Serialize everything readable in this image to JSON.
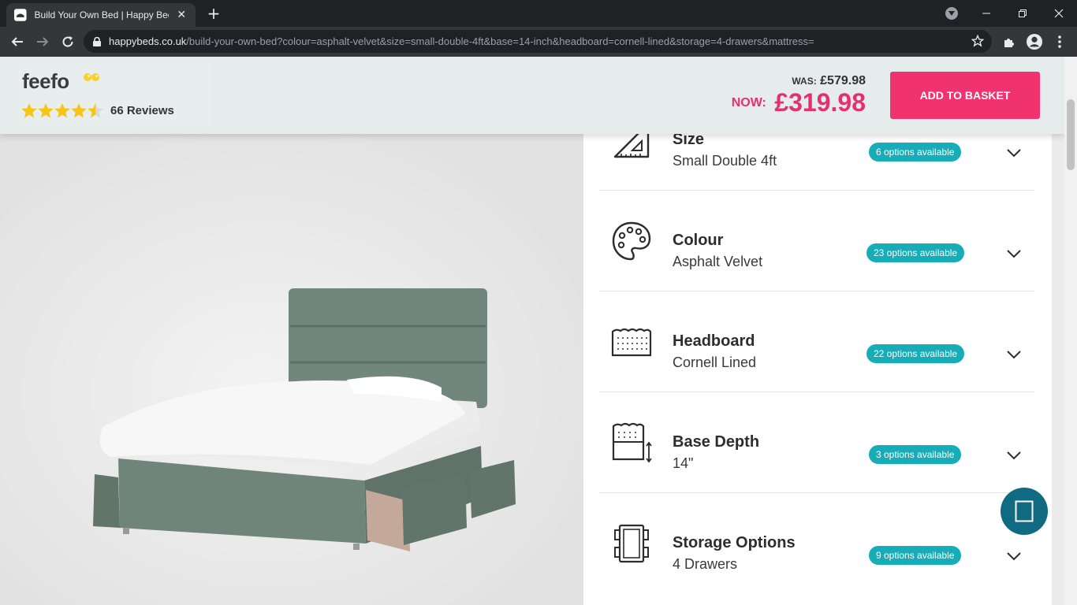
{
  "browser": {
    "tab_title": "Build Your Own Bed | Happy Bed",
    "url_host": "happybeds.co.uk",
    "url_path": "/build-your-own-bed?colour=asphalt-velvet&size=small-double-4ft&base=14-inch&headboard=cornell-lined&storage=4-drawers&mattress="
  },
  "header": {
    "feefo_logo": "feefo",
    "rating": 4.5,
    "reviews": "66 Reviews",
    "was_label": "WAS:",
    "was_price": "£579.98",
    "now_label": "NOW:",
    "now_price": "£319.98",
    "basket_label": "ADD TO BASKET"
  },
  "options": [
    {
      "title": "Size",
      "value": "Small Double 4ft",
      "badge": "6 options available",
      "icon": "set-square-icon"
    },
    {
      "title": "Colour",
      "value": "Asphalt Velvet",
      "badge": "23 options available",
      "icon": "palette-icon"
    },
    {
      "title": "Headboard",
      "value": "Cornell Lined",
      "badge": "22 options available",
      "icon": "headboard-icon"
    },
    {
      "title": "Base Depth",
      "value": "14\"",
      "badge": "3 options available",
      "icon": "base-depth-icon"
    },
    {
      "title": "Storage Options",
      "value": "4 Drawers",
      "badge": "9 options available",
      "icon": "drawers-icon"
    }
  ],
  "colors": {
    "accent_pink": "#f0326f",
    "price_pink": "#e5306f",
    "badge_teal": "#17adb8",
    "chat_blue": "#0f6a82"
  }
}
